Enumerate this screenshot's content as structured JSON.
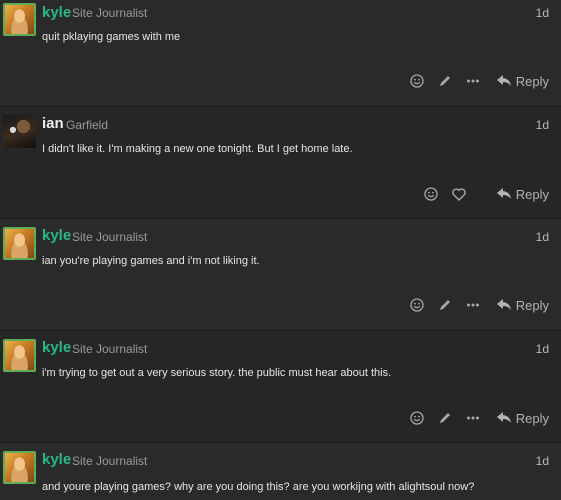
{
  "posts": [
    {
      "username": "kyle",
      "user_title": "Site Journalist",
      "time": "1d",
      "text": "quit pklaying games with me",
      "actions": [
        "smile-icon",
        "pencil-icon",
        "more-icon"
      ],
      "reply_label": "Reply"
    },
    {
      "username": "ian",
      "user_title": "Garfield",
      "time": "1d",
      "text": "I didn't like it. I'm making a new one tonight. But I get home late.",
      "actions": [
        "smile-icon",
        "heart-icon"
      ],
      "reply_label": "Reply"
    },
    {
      "username": "kyle",
      "user_title": "Site Journalist",
      "time": "1d",
      "text": "ian you're playing games and i'm not liking it.",
      "actions": [
        "smile-icon",
        "pencil-icon",
        "more-icon"
      ],
      "reply_label": "Reply"
    },
    {
      "username": "kyle",
      "user_title": "Site Journalist",
      "time": "1d",
      "text": "i'm trying to get out a very serious story. the public must hear about this.",
      "actions": [
        "smile-icon",
        "pencil-icon",
        "more-icon"
      ],
      "reply_label": "Reply"
    },
    {
      "username": "kyle",
      "user_title": "Site Journalist",
      "time": "1d",
      "text": "and youre playing games? why are you doing this? are you workijng with alightsoul now?",
      "actions": [],
      "reply_label": ""
    }
  ],
  "colors": {
    "background": "#222222",
    "kyle_name": "#26b88a",
    "ian_name": "#eeeeee",
    "muted": "#9a9a9a"
  }
}
